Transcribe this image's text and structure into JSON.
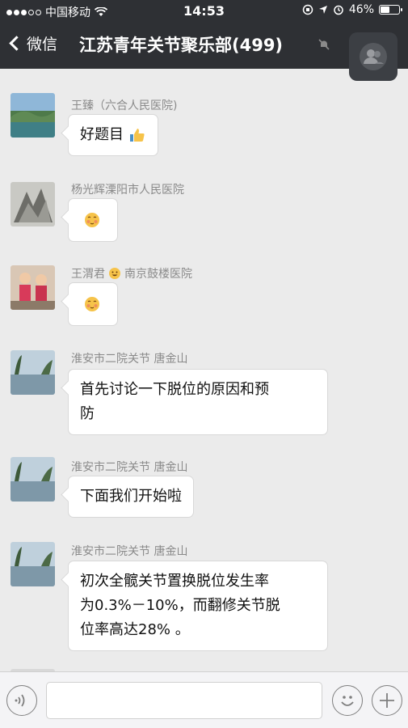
{
  "status_bar": {
    "carrier": "中国移动",
    "time": "14:53",
    "battery": "46%",
    "battery_level": 0.46
  },
  "nav": {
    "back_label": "微信",
    "title": "江苏青年关节聚乐部(499)"
  },
  "messages": [
    {
      "sender": "王臻（六合人民医院)",
      "text": "好题目",
      "has_thumb": true
    },
    {
      "sender": "杨光辉溧阳市人民医院",
      "text": "",
      "emoji_only": true
    },
    {
      "sender": "王渭君",
      "sender_suffix": "南京鼓楼医院",
      "text": "",
      "emoji_only": true
    },
    {
      "sender": "淮安市二院关节  唐金山",
      "lines": [
        "首先讨论一下脱位的原因和预",
        "防"
      ]
    },
    {
      "sender": "淮安市二院关节  唐金山",
      "text": "下面我们开始啦"
    },
    {
      "sender": "淮安市二院关节  唐金山",
      "lines": [
        "初次全髋关节置换脱位发生率",
        "为0.3%－10%，而翻修关节脱",
        "位率高达28% 。"
      ]
    }
  ],
  "icons": {
    "back": "chevron-left-icon",
    "mute": "mute-bell-icon",
    "group": "group-members-icon",
    "voice": "voice-icon",
    "emoji": "emoji-icon",
    "plus": "plus-icon"
  },
  "colors": {
    "nav_bg": "#2e3034",
    "chat_bg": "#ebebeb",
    "bubble_bg": "#ffffff"
  }
}
